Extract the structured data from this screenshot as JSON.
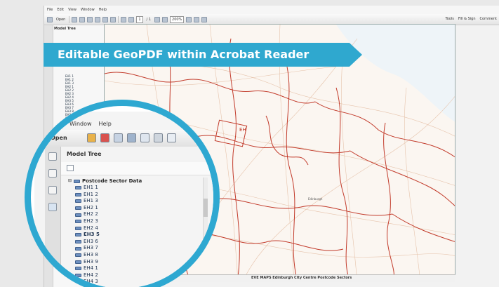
{
  "app": {
    "menu": [
      "File",
      "Edit",
      "View",
      "Window",
      "Help"
    ],
    "toolbar": {
      "open_label": "Open",
      "page_current": "1",
      "page_total": "/ 1",
      "zoom": "200%",
      "right_items": [
        "Tools",
        "Fill & Sign",
        "Comment"
      ]
    },
    "pane": {
      "title": "Model Tree",
      "root_label": "Postcode Sector Data"
    }
  },
  "banner": {
    "text": "Editable GeoPDF within Acrobat Reader"
  },
  "map": {
    "status_text": "EVE MAPS Edinburgh City Centre Postcode Sectors",
    "town_label": "Edinburgh"
  },
  "magnified": {
    "menu": [
      "Window",
      "Help"
    ],
    "open_label": "Open",
    "pane_title": "Model Tree",
    "root_label": "Postcode Sector Data",
    "items": [
      "EH1 1",
      "EH1 2",
      "EH1 3",
      "EH2 1",
      "EH2 2",
      "EH2 3",
      "EH2 4",
      "EH3 5",
      "EH3 6",
      "EH3 7",
      "EH3 8",
      "EH3 9",
      "EH4 1",
      "EH4 2",
      "EH4 3"
    ],
    "bold_item": "EH3 5"
  },
  "colors": {
    "accent": "#2fa8cf",
    "boundary": "#c23a2a",
    "road": "#e8b9a0"
  }
}
